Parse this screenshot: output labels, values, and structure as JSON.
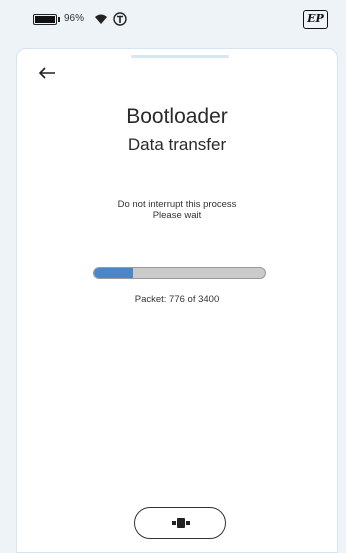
{
  "status_bar": {
    "battery_percent": "96%",
    "icons": [
      "battery-icon",
      "wifi-icon",
      "t-circle-icon"
    ],
    "logo_text": "EP"
  },
  "header": {
    "back_icon": "arrow-left-icon"
  },
  "main": {
    "title": "Bootloader",
    "subtitle": "Data transfer",
    "notice_line1": "Do not interrupt this process",
    "notice_line2": "Please wait",
    "progress": {
      "current": 776,
      "total": 3400,
      "text": "Packet: 776 of 3400"
    }
  },
  "footer": {
    "device_button_icon": "device-connector-icon"
  },
  "colors": {
    "accent": "#4a86c8",
    "track": "#cbcbcb",
    "background": "#eef3f7"
  }
}
